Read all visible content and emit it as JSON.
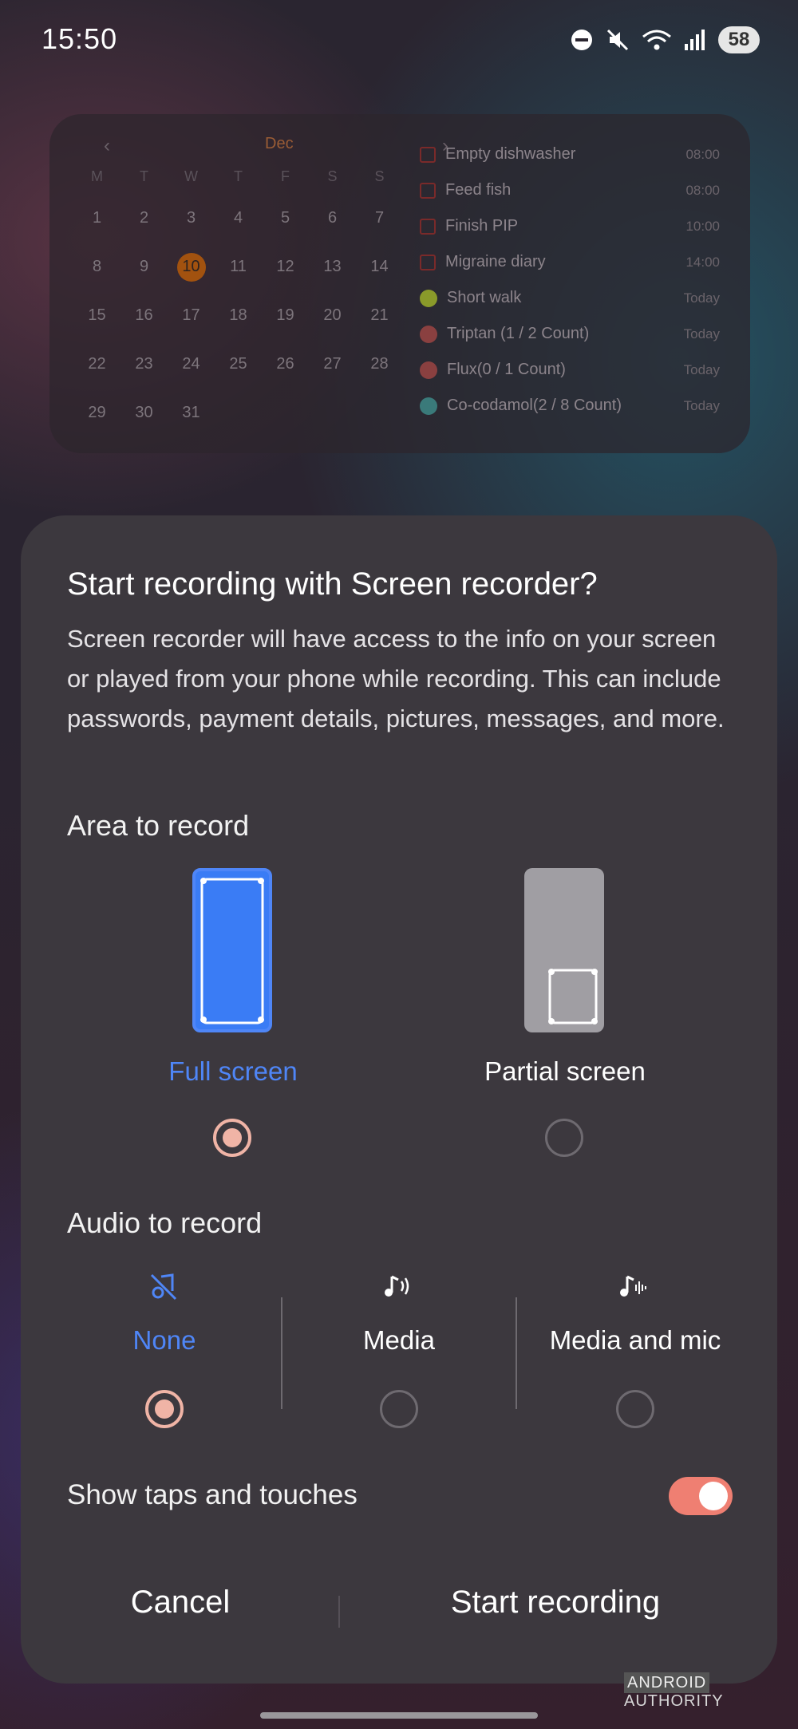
{
  "status_bar": {
    "time": "15:50",
    "battery": "58",
    "icons": [
      "do-not-disturb-icon",
      "mute-icon",
      "wifi-icon",
      "signal-icon"
    ]
  },
  "calendar_widget": {
    "month": "Dec",
    "weekdays": [
      "M",
      "T",
      "W",
      "T",
      "F",
      "S",
      "S"
    ],
    "days": [
      "",
      "",
      "",
      "",
      "",
      "",
      "",
      "1",
      "2",
      "3",
      "4",
      "5",
      "6",
      "7",
      "8",
      "9",
      "10",
      "11",
      "12",
      "13",
      "14",
      "15",
      "16",
      "17",
      "18",
      "19",
      "20",
      "21",
      "22",
      "23",
      "24",
      "25",
      "26",
      "27",
      "28",
      "29",
      "30",
      "31"
    ],
    "today": "10",
    "tasks": [
      {
        "label": "Empty dishwasher",
        "when": "08:00",
        "kind": "checkbox"
      },
      {
        "label": "Feed fish",
        "when": "08:00",
        "kind": "checkbox"
      },
      {
        "label": "Finish PIP",
        "when": "10:00",
        "kind": "checkbox"
      },
      {
        "label": "Migraine diary",
        "when": "14:00",
        "kind": "checkbox"
      },
      {
        "label": "Short walk",
        "when": "Today",
        "kind": "habit",
        "color": "#8a9a2a"
      },
      {
        "label": "Triptan (1 / 2 Count)",
        "when": "Today",
        "kind": "habit",
        "color": "#8a4040"
      },
      {
        "label": "Flux(0 / 1 Count)",
        "when": "Today",
        "kind": "habit",
        "color": "#8a4040"
      },
      {
        "label": "Co-codamol(2 / 8 Count)",
        "when": "Today",
        "kind": "habit",
        "color": "#3a7a7a"
      }
    ]
  },
  "dialog": {
    "title": "Start recording with Screen recorder?",
    "body": "Screen recorder will have access to the info on your screen or played from your phone while recording. This can include passwords, payment details, pictures, messages, and more.",
    "area_section": "Area to record",
    "area_options": [
      {
        "label": "Full screen",
        "selected": true
      },
      {
        "label": "Partial screen",
        "selected": false
      }
    ],
    "audio_section": "Audio to record",
    "audio_options": [
      {
        "label": "None",
        "icon": "music-off-icon",
        "selected": true
      },
      {
        "label": "Media",
        "icon": "media-audio-icon",
        "selected": false
      },
      {
        "label": "Media and mic",
        "icon": "media-mic-icon",
        "selected": false
      }
    ],
    "show_taps_label": "Show taps and touches",
    "show_taps_enabled": true,
    "cancel_label": "Cancel",
    "start_label": "Start recording"
  },
  "colors": {
    "accent_blue": "#4f86f7",
    "radio_selected": "#f0b4a6",
    "toggle_on": "#ef7f72"
  },
  "watermark": {
    "part1": "ANDROID",
    "part2": "AUTHORITY"
  }
}
